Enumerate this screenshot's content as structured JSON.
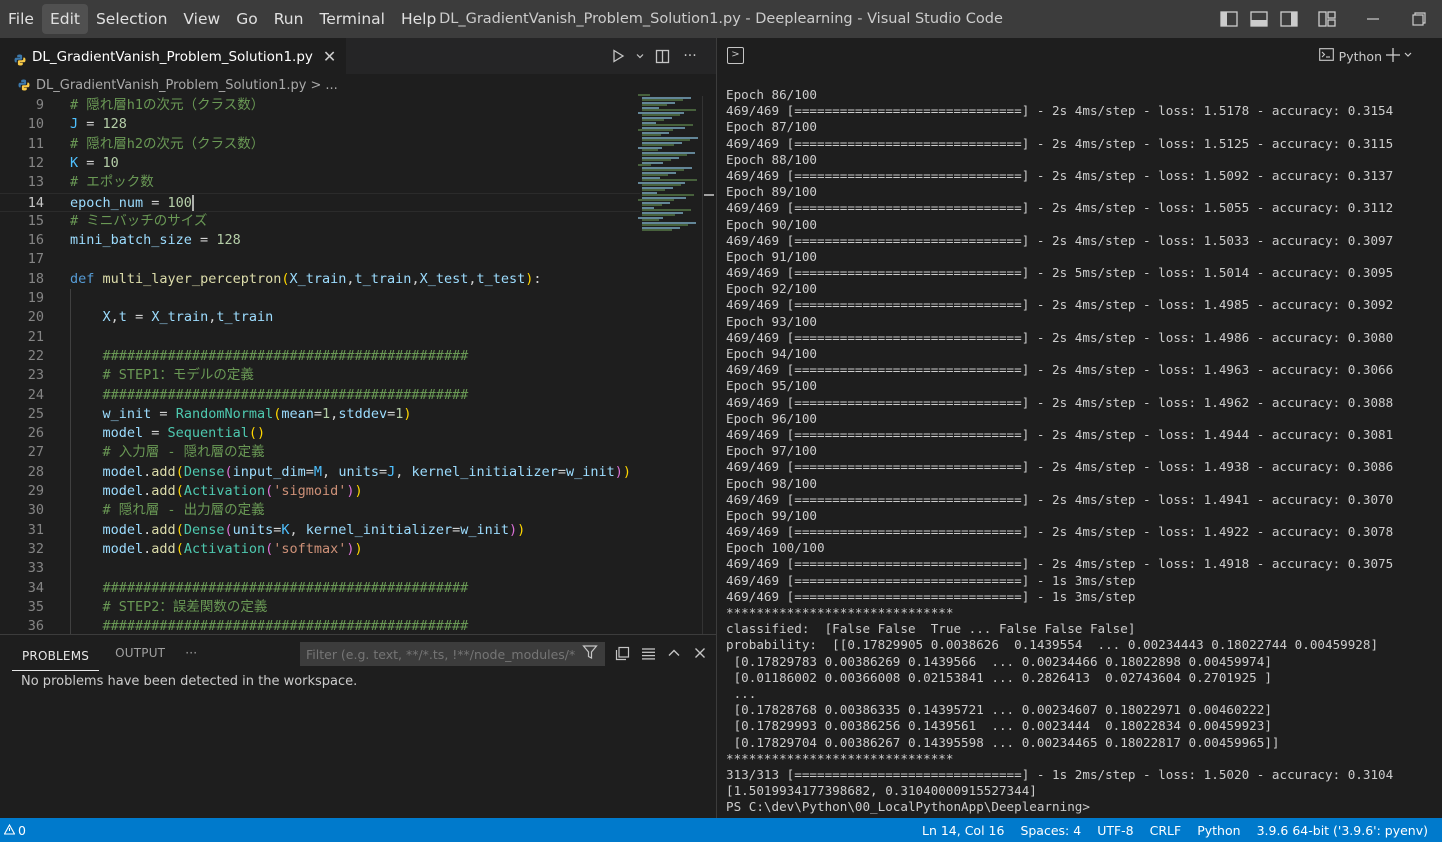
{
  "menu": [
    "File",
    "Edit",
    "Selection",
    "View",
    "Go",
    "Run",
    "Terminal",
    "Help"
  ],
  "window_title": "DL_GradientVanish_Problem_Solution1.py - Deeplearning - Visual Studio Code",
  "tab": {
    "label": "DL_GradientVanish_Problem_Solution1.py",
    "close": "✕"
  },
  "breadcrumb": {
    "file": "DL_GradientVanish_Problem_Solution1.py",
    "sep": ">",
    "more": "..."
  },
  "editor_actions": {
    "more": "···"
  },
  "code_lines": [
    {
      "n": "9",
      "html": "<span class='cmt'># 隠れ層h1の次元（クラス数）</span>"
    },
    {
      "n": "10",
      "html": "<span class='cst'>J</span> = <span class='num'>128</span>"
    },
    {
      "n": "11",
      "html": "<span class='cmt'># 隠れ層h2の次元（クラス数）</span>"
    },
    {
      "n": "12",
      "html": "<span class='cst'>K</span> = <span class='num'>10</span>"
    },
    {
      "n": "13",
      "html": "<span class='cmt'># エポック数</span>"
    },
    {
      "n": "14",
      "html": "<span class='vr'>epoch_num</span> = <span class='num'>100</span><span class='cursor'></span>",
      "current": true
    },
    {
      "n": "15",
      "html": "<span class='cmt'># ミニバッチのサイズ</span>"
    },
    {
      "n": "16",
      "html": "<span class='vr'>mini_batch_size</span> = <span class='num'>128</span>"
    },
    {
      "n": "17",
      "html": ""
    },
    {
      "n": "18",
      "html": "<span class='kw'>def</span> <span class='fn'>multi_layer_perceptron</span><span class='br'>(</span><span class='vr'>X_train</span>,<span class='vr'>t_train</span>,<span class='vr'>X_test</span>,<span class='vr'>t_test</span><span class='br'>)</span>:"
    },
    {
      "n": "19",
      "html": ""
    },
    {
      "n": "20",
      "html": "    <span class='vr'>X</span>,<span class='vr'>t</span> = <span class='vr'>X_train</span>,<span class='vr'>t_train</span>"
    },
    {
      "n": "21",
      "html": ""
    },
    {
      "n": "22",
      "html": "    <span class='cmt'>#############################################</span>"
    },
    {
      "n": "23",
      "html": "    <span class='cmt'># STEP1：モデルの定義</span>"
    },
    {
      "n": "24",
      "html": "    <span class='cmt'>#############################################</span>"
    },
    {
      "n": "25",
      "html": "    <span class='vr'>w_init</span> = <span class='cls'>RandomNormal</span><span class='br'>(</span><span class='vr'>mean</span>=<span class='num'>1</span>,<span class='vr'>stddev</span>=<span class='num'>1</span><span class='br'>)</span>"
    },
    {
      "n": "26",
      "html": "    <span class='vr'>model</span> = <span class='cls'>Sequential</span><span class='br'>()</span>"
    },
    {
      "n": "27",
      "html": "    <span class='cmt'># 入力層 - 隠れ層の定義</span>"
    },
    {
      "n": "28",
      "html": "    <span class='vr'>model</span>.<span class='fn'>add</span><span class='br'>(</span><span class='cls'>Dense</span><span class='br2'>(</span><span class='vr'>input_dim</span>=<span class='cst'>M</span>, <span class='vr'>units</span>=<span class='cst'>J</span>, <span class='vr'>kernel_initializer</span>=<span class='vr'>w_init</span><span class='br2'>)</span><span class='br'>)</span>"
    },
    {
      "n": "29",
      "html": "    <span class='vr'>model</span>.<span class='fn'>add</span><span class='br'>(</span><span class='cls'>Activation</span><span class='br2'>(</span><span class='str'>'sigmoid'</span><span class='br2'>)</span><span class='br'>)</span>"
    },
    {
      "n": "30",
      "html": "    <span class='cmt'># 隠れ層 - 出力層の定義</span>"
    },
    {
      "n": "31",
      "html": "    <span class='vr'>model</span>.<span class='fn'>add</span><span class='br'>(</span><span class='cls'>Dense</span><span class='br2'>(</span><span class='vr'>units</span>=<span class='cst'>K</span>, <span class='vr'>kernel_initializer</span>=<span class='vr'>w_init</span><span class='br2'>)</span><span class='br'>)</span>"
    },
    {
      "n": "32",
      "html": "    <span class='vr'>model</span>.<span class='fn'>add</span><span class='br'>(</span><span class='cls'>Activation</span><span class='br2'>(</span><span class='str'>'softmax'</span><span class='br2'>)</span><span class='br'>)</span>"
    },
    {
      "n": "33",
      "html": ""
    },
    {
      "n": "34",
      "html": "    <span class='cmt'>#############################################</span>"
    },
    {
      "n": "35",
      "html": "    <span class='cmt'># STEP2：誤差関数の定義</span>"
    },
    {
      "n": "36",
      "html": "    <span class='cmt'>#############################################</span>"
    }
  ],
  "panel": {
    "tabs": [
      "PROBLEMS",
      "OUTPUT"
    ],
    "more": "···",
    "filter_placeholder": "Filter (e.g. text, **/*.ts, !**/node_modules/**)",
    "message": "No problems have been detected in the workspace."
  },
  "terminal": {
    "profile": "Python",
    "lines": [
      "Epoch 86/100",
      "469/469 [==============================] - 2s 4ms/step - loss: 1.5178 - accuracy: 0.3154",
      "Epoch 87/100",
      "469/469 [==============================] - 2s 4ms/step - loss: 1.5125 - accuracy: 0.3115",
      "Epoch 88/100",
      "469/469 [==============================] - 2s 4ms/step - loss: 1.5092 - accuracy: 0.3137",
      "Epoch 89/100",
      "469/469 [==============================] - 2s 4ms/step - loss: 1.5055 - accuracy: 0.3112",
      "Epoch 90/100",
      "469/469 [==============================] - 2s 4ms/step - loss: 1.5033 - accuracy: 0.3097",
      "Epoch 91/100",
      "469/469 [==============================] - 2s 5ms/step - loss: 1.5014 - accuracy: 0.3095",
      "Epoch 92/100",
      "469/469 [==============================] - 2s 4ms/step - loss: 1.4985 - accuracy: 0.3092",
      "Epoch 93/100",
      "469/469 [==============================] - 2s 4ms/step - loss: 1.4986 - accuracy: 0.3080",
      "Epoch 94/100",
      "469/469 [==============================] - 2s 4ms/step - loss: 1.4963 - accuracy: 0.3066",
      "Epoch 95/100",
      "469/469 [==============================] - 2s 4ms/step - loss: 1.4962 - accuracy: 0.3088",
      "Epoch 96/100",
      "469/469 [==============================] - 2s 4ms/step - loss: 1.4944 - accuracy: 0.3081",
      "Epoch 97/100",
      "469/469 [==============================] - 2s 4ms/step - loss: 1.4938 - accuracy: 0.3086",
      "Epoch 98/100",
      "469/469 [==============================] - 2s 4ms/step - loss: 1.4941 - accuracy: 0.3070",
      "Epoch 99/100",
      "469/469 [==============================] - 2s 4ms/step - loss: 1.4922 - accuracy: 0.3078",
      "Epoch 100/100",
      "469/469 [==============================] - 2s 4ms/step - loss: 1.4918 - accuracy: 0.3075",
      "469/469 [==============================] - 1s 3ms/step",
      "469/469 [==============================] - 1s 3ms/step",
      "******************************",
      "classified:  [False False  True ... False False False]",
      "probability:  [[0.17829905 0.0038626  0.1439554  ... 0.00234443 0.18022744 0.00459928]",
      " [0.17829783 0.00386269 0.1439566  ... 0.00234466 0.18022898 0.00459974]",
      " [0.01186002 0.00366008 0.02153841 ... 0.2826413  0.02743604 0.2701925 ]",
      " ...",
      " [0.17828768 0.00386335 0.14395721 ... 0.00234607 0.18022971 0.00460222]",
      " [0.17829993 0.00386256 0.1439561  ... 0.0023444  0.18022834 0.00459923]",
      " [0.17829704 0.00386267 0.14395598 ... 0.00234465 0.18022817 0.00459965]]",
      "******************************",
      "313/313 [==============================] - 1s 2ms/step - loss: 1.5020 - accuracy: 0.3104",
      "[1.5019934177398682, 0.31040000915527344]",
      "PS C:\\dev\\Python\\00_LocalPythonApp\\Deeplearning>"
    ]
  },
  "statusbar": {
    "problems_count": "0",
    "position": "Ln 14, Col 16",
    "spaces": "Spaces: 4",
    "encoding": "UTF-8",
    "eol": "CRLF",
    "language": "Python",
    "interpreter": "3.9.6 64-bit ('3.9.6': pyenv)"
  },
  "colors": {
    "statusbar": "#007acc",
    "titlebar": "#3c3c3c",
    "editor_bg": "#1e1e1e"
  }
}
